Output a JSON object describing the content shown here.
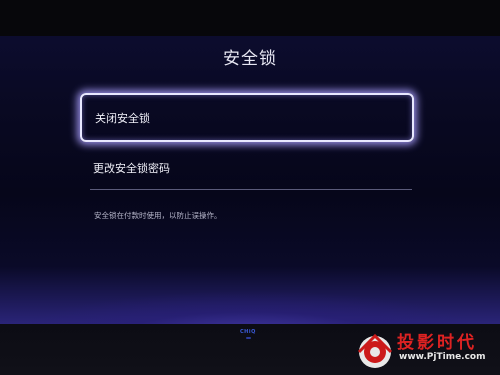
{
  "screen": {
    "title": "安全锁",
    "menu": [
      {
        "label": "关闭安全锁",
        "selected": true
      },
      {
        "label": "更改安全锁密码",
        "selected": false
      }
    ],
    "hint": "安全锁在付款时使用，以防止误操作。"
  },
  "bezel": {
    "brand": "CHiQ"
  },
  "watermark": {
    "title": "投影时代",
    "url": "www.PjTime.com"
  },
  "colors": {
    "highlight_border": "#e8e8ff",
    "glow": "#aaa0ff",
    "background": "#06061a",
    "watermark_red": "#dd2222"
  }
}
